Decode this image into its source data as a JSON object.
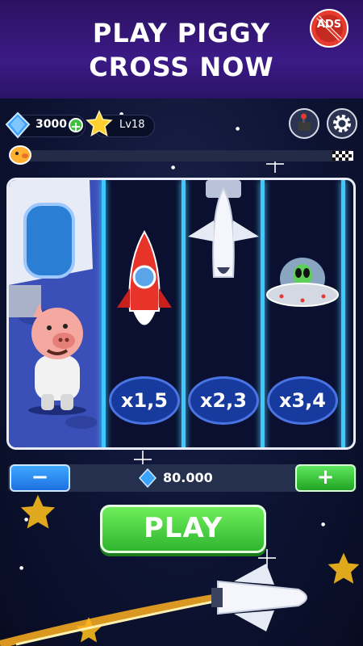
{
  "banner": {
    "line1": "PLAY PIGGY",
    "line2": "CROSS NOW",
    "noads_label": "ADS"
  },
  "hud": {
    "gems": "3000",
    "gem_plus": "+",
    "level": "Lv18"
  },
  "lanes": {
    "multipliers": [
      "x1,5",
      "x2,3",
      "x3,4"
    ]
  },
  "bet": {
    "minus": "−",
    "amount": "80.000",
    "plus": "+"
  },
  "play_button": "PLAY",
  "colors": {
    "banner": "#3b1a86",
    "lane_line": "#3dc8ff",
    "multiplier_oval": "#173a9e",
    "play": "#2fb52f",
    "minus": "#1d70e0"
  }
}
